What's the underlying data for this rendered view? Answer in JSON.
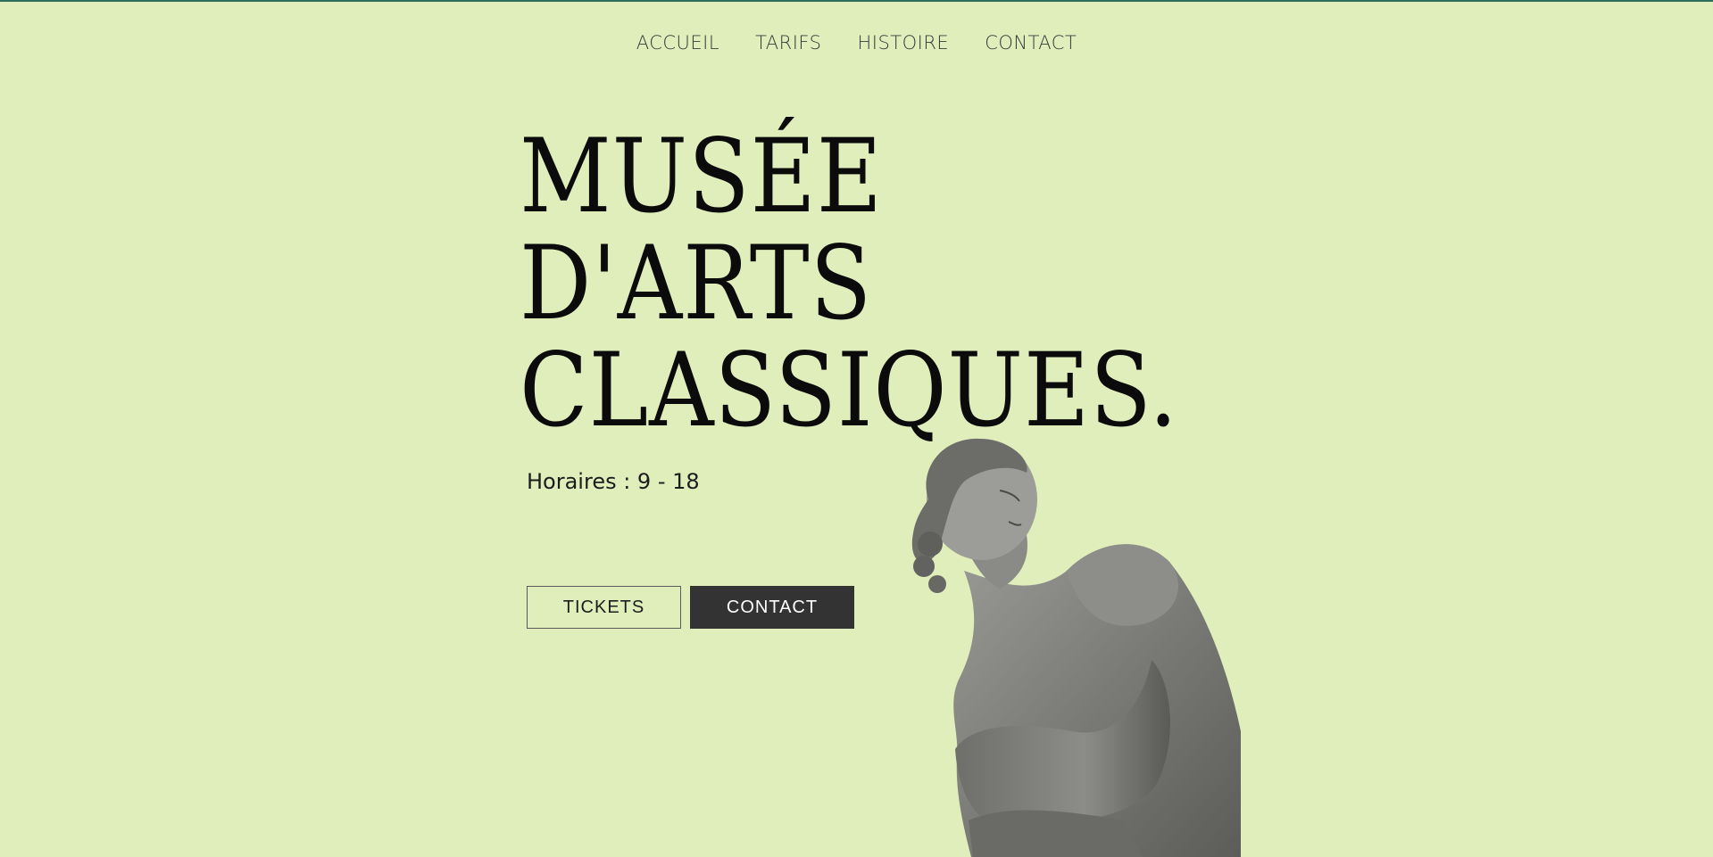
{
  "nav": {
    "items": [
      {
        "label": "ACCUEIL"
      },
      {
        "label": "TARIFS"
      },
      {
        "label": "HISTOIRE"
      },
      {
        "label": "CONTACT"
      }
    ]
  },
  "hero": {
    "title_lines": [
      "MUSÉE",
      "D'ARTS",
      "CLASSIQUES."
    ],
    "hours": "Horaires : 9 - 18"
  },
  "buttons": {
    "tickets_label": "TICKETS",
    "contact_label": "CONTACT"
  },
  "colors": {
    "background": "#e0eebc",
    "primary_button": "#333333",
    "title_text": "#0b0b0b"
  }
}
